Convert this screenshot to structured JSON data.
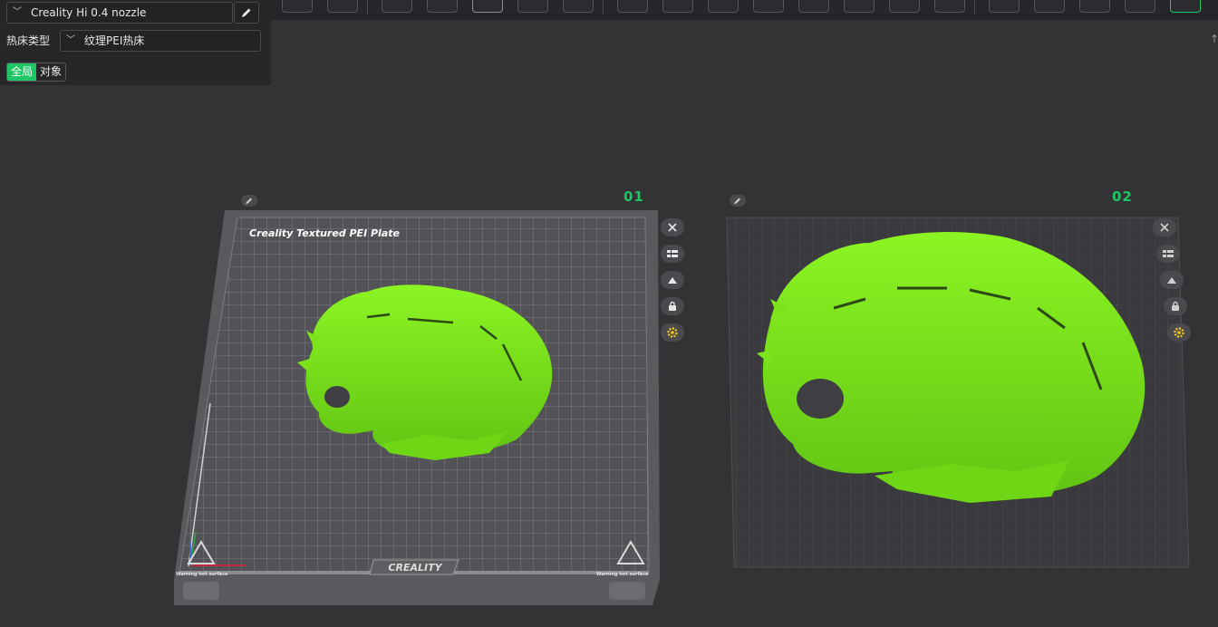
{
  "panel": {
    "nozzle": "Creality Hi 0.4 nozzle",
    "bed_label": "热床类型",
    "bed_type": "纹理PEI热床",
    "scope_tabs": [
      "全局",
      "对象"
    ]
  },
  "plates": [
    {
      "number": "01",
      "title": "Creality Textured PEI Plate",
      "brand": "CREALITY",
      "warning": "Warning hot surface"
    },
    {
      "number": "02"
    }
  ],
  "icons": {
    "nozzle_chevron": "chevron-down-icon",
    "edit": "pencil-icon",
    "plate_controls": [
      "close-icon",
      "arrange-icon",
      "auto-orient-icon",
      "lock-icon",
      "settings-gear-icon"
    ]
  },
  "colors": {
    "accent": "#1ec663",
    "model": "#7be21c",
    "background": "#333336",
    "gear": "#f5c518"
  }
}
